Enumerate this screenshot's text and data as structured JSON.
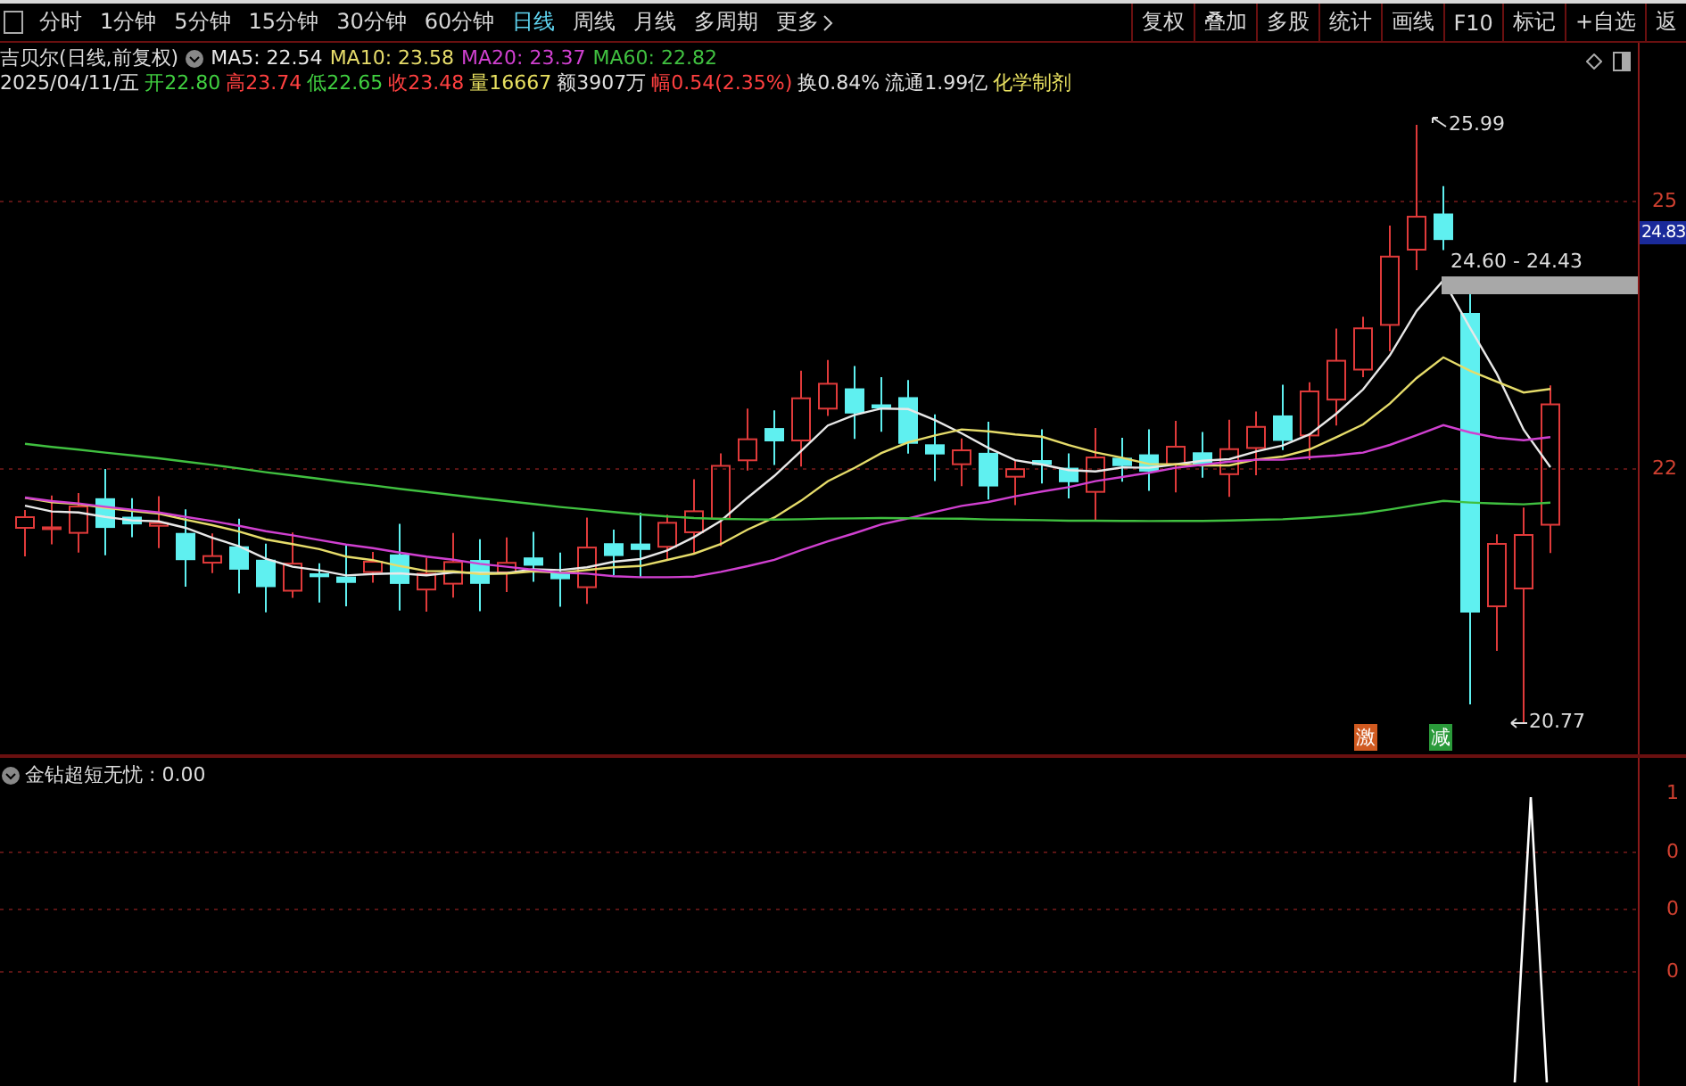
{
  "period_tabs": [
    {
      "label": "分时",
      "selected": false
    },
    {
      "label": "1分钟",
      "selected": false
    },
    {
      "label": "5分钟",
      "selected": false
    },
    {
      "label": "15分钟",
      "selected": false
    },
    {
      "label": "30分钟",
      "selected": false
    },
    {
      "label": "60分钟",
      "selected": false
    },
    {
      "label": "日线",
      "selected": true
    },
    {
      "label": "周线",
      "selected": false
    },
    {
      "label": "月线",
      "selected": false
    },
    {
      "label": "多周期",
      "selected": false
    },
    {
      "label": "更多",
      "selected": false
    }
  ],
  "toolbar_buttons": [
    "复权",
    "叠加",
    "多股",
    "统计",
    "画线",
    "F10",
    "标记",
    "+自选",
    "返"
  ],
  "chart": {
    "title": "吉贝尔(日线,前复权)",
    "ma_legend": [
      {
        "label": "MA5: 22.54",
        "color": "#e8e8e8"
      },
      {
        "label": "MA10: 23.58",
        "color": "#e6dc6a"
      },
      {
        "label": "MA20: 23.37",
        "color": "#d040d0"
      },
      {
        "label": "MA60: 22.82",
        "color": "#40c040"
      }
    ],
    "quote": [
      {
        "text": "2025/04/11/五",
        "color": "#e0e0e0"
      },
      {
        "text": "开22.80",
        "color": "#40d040"
      },
      {
        "text": "高23.74",
        "color": "#ff4040"
      },
      {
        "text": "低22.65",
        "color": "#40d040"
      },
      {
        "text": "收23.48",
        "color": "#ff4040"
      },
      {
        "text": "量16667",
        "color": "#e8e060"
      },
      {
        "text": "额3907万",
        "color": "#e0e0e0"
      },
      {
        "text": "幅0.54(2.35%)",
        "color": "#ff4040"
      },
      {
        "text": "换0.84%",
        "color": "#e0e0e0"
      },
      {
        "text": "流通1.99亿",
        "color": "#e0e0e0"
      },
      {
        "text": "化学制剂",
        "color": "#e8e060"
      }
    ],
    "annotations": {
      "high": "25.99",
      "low": "20.77",
      "range": "24.60 - 24.43"
    },
    "signals": [
      {
        "label": "激",
        "color": "#d05a20"
      },
      {
        "label": "减",
        "color": "#2a9a3a"
      }
    ],
    "price_axis": [
      {
        "label": "25",
        "kind": "tick"
      },
      {
        "label": "24.83",
        "kind": "current"
      },
      {
        "label": "22",
        "kind": "tick"
      }
    ]
  },
  "indicator": {
    "label": "金钻超短无忧 : 0.00",
    "axis": [
      "1",
      "0",
      "0",
      "0"
    ]
  }
}
